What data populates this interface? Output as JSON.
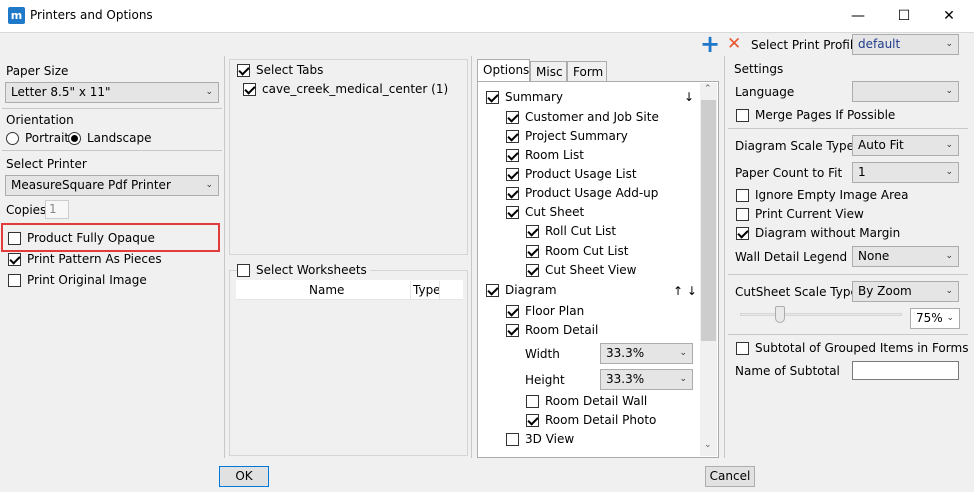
{
  "window": {
    "title": "Printers and Options",
    "app_icon": "m",
    "minimize": "—",
    "maximize": "☐",
    "close": "✕"
  },
  "toolbar": {
    "add_icon": "+",
    "delete_icon": "✕",
    "profile_label": "Select Print Profile",
    "profile_value": "default"
  },
  "left": {
    "paper_size_label": "Paper Size",
    "paper_size_value": "Letter 8.5\" x 11\"",
    "orientation_label": "Orientation",
    "portrait": "Portrait",
    "landscape": "Landscape",
    "printer_label": "Select Printer",
    "printer_value": "MeasureSquare Pdf Printer",
    "copies_label": "Copies",
    "copies_value": "1",
    "opaque": "Product Fully Opaque",
    "pattern": "Print Pattern As Pieces",
    "original": "Print Original Image"
  },
  "tabs_panel": {
    "label": "Select Tabs",
    "item": "cave_creek_medical_center (1)"
  },
  "worksheets": {
    "label": "Select Worksheets",
    "col_name": "Name",
    "col_type": "Type"
  },
  "options_tabs": [
    "Options",
    "Misc",
    "Form"
  ],
  "options": {
    "summary": "Summary",
    "summary_arrow": "↓",
    "customer": "Customer and Job Site",
    "project": "Project Summary",
    "room_list": "Room List",
    "usage_list": "Product Usage List",
    "usage_addup": "Product Usage Add-up",
    "cut_sheet": "Cut Sheet",
    "roll_cut": "Roll Cut List",
    "room_cut": "Room Cut List",
    "cut_view": "Cut Sheet View",
    "diagram": "Diagram",
    "diagram_arrows": "↑ ↓",
    "floor_plan": "Floor Plan",
    "room_detail": "Room Detail",
    "width_label": "Width",
    "width_value": "33.3%",
    "height_label": "Height",
    "height_value": "33.3%",
    "detail_wall": "Room Detail Wall",
    "detail_photo": "Room Detail Photo",
    "view3d": "3D View"
  },
  "settings": {
    "label": "Settings",
    "language_label": "Language",
    "language_value": "",
    "merge": "Merge Pages If Possible",
    "scale_type_label": "Diagram Scale Type",
    "scale_type_value": "Auto Fit",
    "paper_count_label": "Paper Count to Fit",
    "paper_count_value": "1",
    "ignore_empty": "Ignore Empty Image Area",
    "print_current": "Print Current View",
    "no_margin": "Diagram without Margin",
    "wall_legend_label": "Wall Detail Legend",
    "wall_legend_value": "None",
    "cutsheet_scale_label": "CutSheet Scale Type",
    "cutsheet_scale_value": "By Zoom",
    "zoom_value": "75%",
    "subtotal": "Subtotal of Grouped Items in Forms",
    "subtotal_name_label": "Name of Subtotal",
    "subtotal_name_value": ""
  },
  "buttons": {
    "ok": "OK",
    "cancel": "Cancel"
  },
  "colors": {
    "accent_blue": "#1f78c8",
    "delete_red": "#e8542f",
    "highlight": "#e23b3b"
  }
}
